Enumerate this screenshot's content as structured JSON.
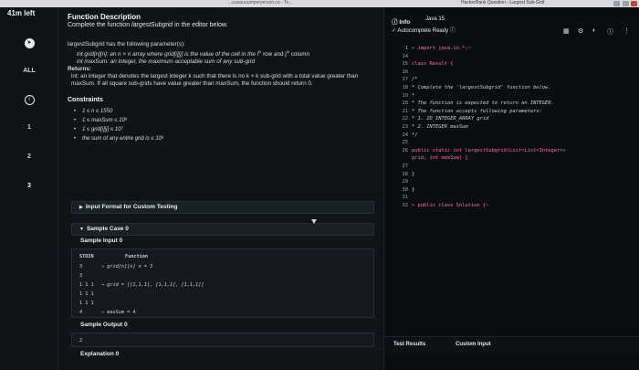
{
  "browser": {
    "left_title": "...uuuuuuumperyerson.ca - To...",
    "right_title": "HackerRank Question - Largest Sub-Grid"
  },
  "rail": {
    "timer": "41m left",
    "all_label": "ALL",
    "questions": [
      "1",
      "2",
      "3"
    ]
  },
  "description": {
    "heading": "Function Description",
    "subheading_prefix": "Complete the function ",
    "subheading_fn": "largestSubgrid",
    "subheading_suffix": " in the editor below.",
    "params_intro": "largestSubgrid has the following parameter(s):",
    "param1_a": "int grid[n][n]: an n × n array where grid[i][j] is the value of the cell in the i",
    "param1_sup1": "th",
    "param1_b": " row and j",
    "param1_sup2": "th",
    "param1_c": " column",
    "param2": "int maxSum: an integer, the maximum acceptable sum of any sub-grid",
    "returns_label": "Returns:",
    "returns_text": "int: an integer that denotes the largest integer k such that there is no k × k sub-grid with a total value greater than maxSum. If all square sub-grids have value greater than maxSum, the function should return 0.",
    "constraints_title": "Constraints",
    "constraints": [
      "1 ≤ n ≤ 1550",
      "1 ≤ maxSum ≤ 10⁶",
      "1 ≤ grid[i][j] ≤ 10⁷",
      "the sum of any entire grid is ≤ 10⁶"
    ],
    "input_format_label": "Input Format for Custom Testing",
    "sample_case_label": "Sample Case 0",
    "sample_input_label": "Sample Input 0",
    "stdin_header": "STDIN",
    "function_header": "Function",
    "sample_rows": [
      {
        "stdin": "3",
        "fn": "→   grid[n][n]   n = 3"
      },
      {
        "stdin": "3",
        "fn": ""
      },
      {
        "stdin": "1 1 1",
        "fn": "→   grid =  [[1,1,1], [1,1,1], [1,1,1]]"
      },
      {
        "stdin": "1 1 1",
        "fn": ""
      },
      {
        "stdin": "1 1 1",
        "fn": ""
      },
      {
        "stdin": "4",
        "fn": "→   maxSum = 4"
      }
    ],
    "sample_output_label": "Sample Output 0",
    "sample_output_value": "2",
    "explanation_label": "Explanation 0"
  },
  "editor": {
    "info_tab": "Info",
    "language": "Java 15",
    "autocomplete": "Autocomplete Ready",
    "lines": [
      {
        "n": "1",
        "text": "> import java.io.*;~"
      },
      {
        "n": "14",
        "text": ""
      },
      {
        "n": "15",
        "text": "class Result {"
      },
      {
        "n": "16",
        "text": ""
      },
      {
        "n": "17",
        "text": "    /*"
      },
      {
        "n": "18",
        "text": "     * Complete the 'largestSubgrid' function below."
      },
      {
        "n": "19",
        "text": "     *"
      },
      {
        "n": "20",
        "text": "     * The function is expected to return an INTEGER."
      },
      {
        "n": "21",
        "text": "     * The function accepts following parameters:"
      },
      {
        "n": "22",
        "text": "     *  1. 2D_INTEGER_ARRAY grid"
      },
      {
        "n": "23",
        "text": "     *  2. INTEGER maxSum"
      },
      {
        "n": "24",
        "text": "     */"
      },
      {
        "n": "25",
        "text": ""
      },
      {
        "n": "26",
        "text": "    public static int largestSubgrid(List<List<Integer>>"
      },
      {
        "n": "",
        "text": "grid, int maxSum) {"
      },
      {
        "n": "27",
        "text": ""
      },
      {
        "n": "28",
        "text": "    }"
      },
      {
        "n": "29",
        "text": ""
      },
      {
        "n": "30",
        "text": "}"
      },
      {
        "n": "31",
        "text": ""
      },
      {
        "n": "32",
        "text": "> public class Solution {~"
      }
    ],
    "test_results": "Test Results",
    "custom_input": "Custom Input"
  },
  "icons": {
    "grid": "grid-icon",
    "settings": "gear-icon",
    "theme": "circle-half-icon",
    "help": "help-icon",
    "more": "more-vertical-icon"
  }
}
